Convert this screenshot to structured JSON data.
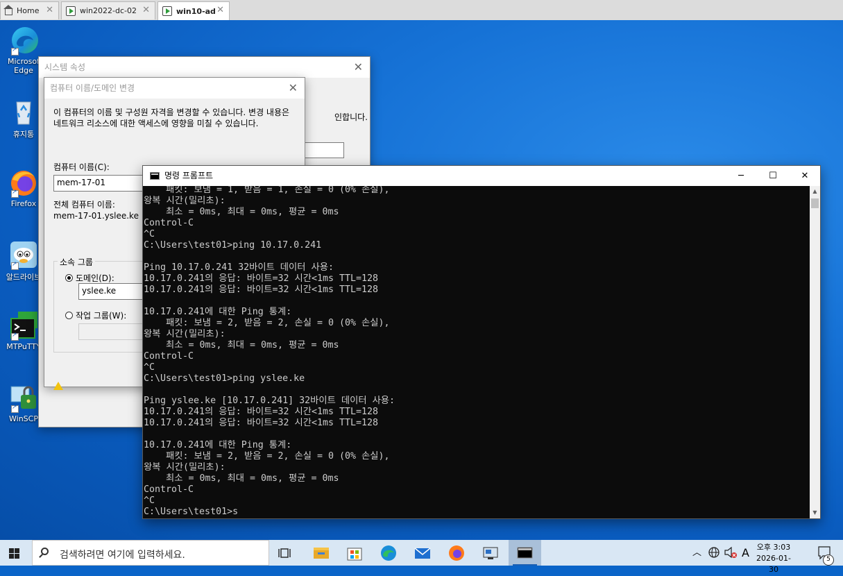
{
  "vm_tabs": [
    {
      "label": "Home"
    },
    {
      "label": "win2022-dc-02"
    },
    {
      "label": "win10-ad"
    }
  ],
  "desktop_icons": [
    {
      "label": "Microsoft Edge",
      "line1": "Microsof",
      "line2": "Edge"
    },
    {
      "label": "휴지통"
    },
    {
      "label": "Firefox"
    },
    {
      "label": "알드라이브"
    },
    {
      "label": "MTPuTTY"
    },
    {
      "label": "WinSCP"
    }
  ],
  "system_props": {
    "title": "시스템 속성",
    "partial_text": "인합니다."
  },
  "rename_dialog": {
    "title": "컴퓨터 이름/도메인 변경",
    "description": "이 컴퓨터의 이름 및 구성원 자격을 변경할 수 있습니다. 변경 내용은 네트워크 리소스에 대한 액세스에 영향을 미칠 수 있습니다.",
    "computer_name_label": "컴퓨터 이름(C):",
    "computer_name_value": "mem-17-01",
    "full_name_label": "전체 컴퓨터 이름:",
    "full_name_value": "mem-17-01.yslee.ke",
    "member_of_label": "소속 그룹",
    "domain_label": "도메인(D):",
    "domain_value": "yslee.ke",
    "workgroup_label": "작업 그룹(W):",
    "workgroup_value": ""
  },
  "cmd": {
    "title": "명령 프롬프트",
    "minimize": "─",
    "maximize": "☐",
    "close": "✕",
    "output": "    패킷: 보냄 = 1, 받음 = 1, 손실 = 0 (0% 손실),\n왕복 시간(밀리초):\n    최소 = 0ms, 최대 = 0ms, 평균 = 0ms\nControl-C\n^C\nC:\\Users\\test01>ping 10.17.0.241\n\nPing 10.17.0.241 32바이트 데이터 사용:\n10.17.0.241의 응답: 바이트=32 시간<1ms TTL=128\n10.17.0.241의 응답: 바이트=32 시간<1ms TTL=128\n\n10.17.0.241에 대한 Ping 통계:\n    패킷: 보냄 = 2, 받음 = 2, 손실 = 0 (0% 손실),\n왕복 시간(밀리초):\n    최소 = 0ms, 최대 = 0ms, 평균 = 0ms\nControl-C\n^C\nC:\\Users\\test01>ping yslee.ke\n\nPing yslee.ke [10.17.0.241] 32바이트 데이터 사용:\n10.17.0.241의 응답: 바이트=32 시간<1ms TTL=128\n10.17.0.241의 응답: 바이트=32 시간<1ms TTL=128\n\n10.17.0.241에 대한 Ping 통계:\n    패킷: 보냄 = 2, 받음 = 2, 손실 = 0 (0% 손실),\n왕복 시간(밀리초):\n    최소 = 0ms, 최대 = 0ms, 평균 = 0ms\nControl-C\n^C\nC:\\Users\\test01>s"
  },
  "taskbar": {
    "search_placeholder": "검색하려면 여기에 입력하세요.",
    "ime": "A",
    "time": "오후 3:03",
    "date": "2026-01-30",
    "notification_count": "5"
  }
}
